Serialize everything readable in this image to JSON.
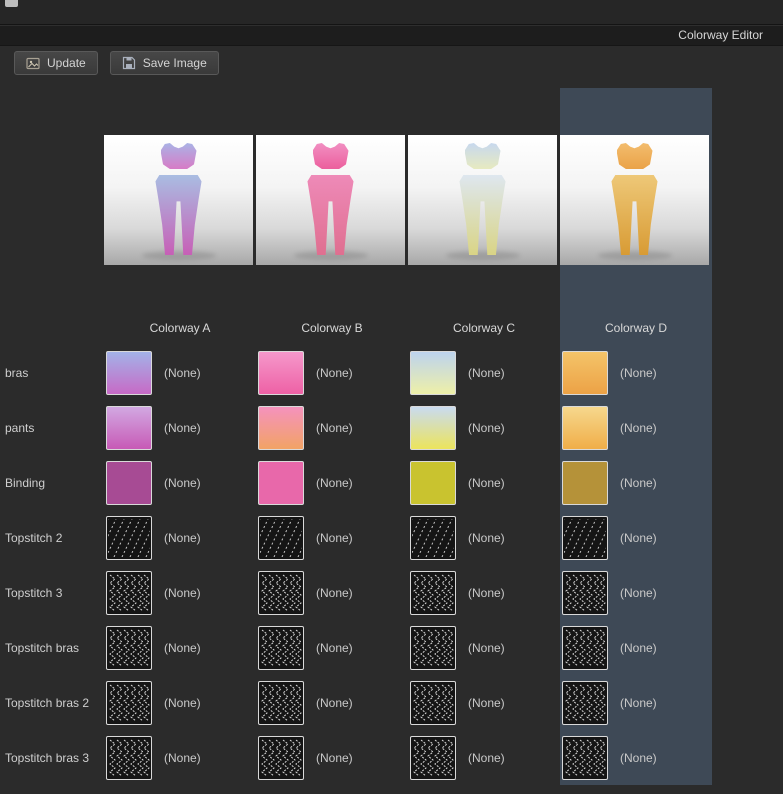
{
  "window": {
    "title": "Colorway Editor"
  },
  "toolbar": {
    "update_label": "Update",
    "save_image_label": "Save Image"
  },
  "table": {
    "columns": [
      {
        "label": "Colorway A",
        "selected": false,
        "thumb_bra": "linear-gradient(180deg,#aab3e6,#d77bc6)",
        "thumb_pants": "linear-gradient(180deg,#a9bde2,#c75fb6)"
      },
      {
        "label": "Colorway B",
        "selected": false,
        "thumb_bra": "linear-gradient(180deg,#f18fc2,#ec5f9d)",
        "thumb_pants": "linear-gradient(180deg,#ee8ab8,#df6f90)"
      },
      {
        "label": "Colorway C",
        "selected": false,
        "thumb_bra": "linear-gradient(180deg,#c7d8ee,#e7eac0)",
        "thumb_pants": "linear-gradient(180deg,#dee7ef,#d9d485)"
      },
      {
        "label": "Colorway D",
        "selected": true,
        "thumb_bra": "linear-gradient(180deg,#f3bd6e,#eaa348)",
        "thumb_pants": "linear-gradient(180deg,#eec878,#d89b34)"
      }
    ],
    "rows": [
      {
        "label": "bras",
        "kind": "color",
        "swatches": [
          "linear-gradient(180deg,#a3b2e8,#c76ac6)",
          "linear-gradient(180deg,#f598cb,#ee61a5)",
          "linear-gradient(180deg,#bdd3ee,#eef0a8)",
          "linear-gradient(180deg,#f4c469,#eca246)"
        ],
        "values": [
          "(None)",
          "(None)",
          "(None)",
          "(None)"
        ]
      },
      {
        "label": "pants",
        "kind": "color",
        "swatches": [
          "linear-gradient(180deg,#d2a8e2,#c75ab6)",
          "linear-gradient(180deg,#f592bd,#f2a365)",
          "linear-gradient(180deg,#c9dbf0,#ece45c)",
          "linear-gradient(180deg,#f6d88d,#f0ae48)"
        ],
        "values": [
          "(None)",
          "(None)",
          "(None)",
          "(None)"
        ]
      },
      {
        "label": "Binding",
        "kind": "color",
        "swatches": [
          "#a74b94",
          "#e868aa",
          "#c9c32f",
          "#b59239"
        ],
        "values": [
          "(None)",
          "(None)",
          "(None)",
          "(None)"
        ]
      },
      {
        "label": "Topstitch 2",
        "kind": "stitch",
        "pattern": "diagonal",
        "values": [
          "(None)",
          "(None)",
          "(None)",
          "(None)"
        ]
      },
      {
        "label": "Topstitch 3",
        "kind": "stitch",
        "pattern": "zigzag",
        "values": [
          "(None)",
          "(None)",
          "(None)",
          "(None)"
        ]
      },
      {
        "label": "Topstitch bras",
        "kind": "stitch",
        "pattern": "zigzag",
        "values": [
          "(None)",
          "(None)",
          "(None)",
          "(None)"
        ]
      },
      {
        "label": "Topstitch bras 2",
        "kind": "stitch",
        "pattern": "zigzag",
        "values": [
          "(None)",
          "(None)",
          "(None)",
          "(None)"
        ]
      },
      {
        "label": "Topstitch bras 3",
        "kind": "stitch",
        "pattern": "zigzag",
        "values": [
          "(None)",
          "(None)",
          "(None)",
          "(None)"
        ]
      }
    ]
  },
  "colors": {
    "background": "#2b2b2b",
    "selection_highlight": "#3a4a5c",
    "swatch_border": "#d9d9d9"
  }
}
